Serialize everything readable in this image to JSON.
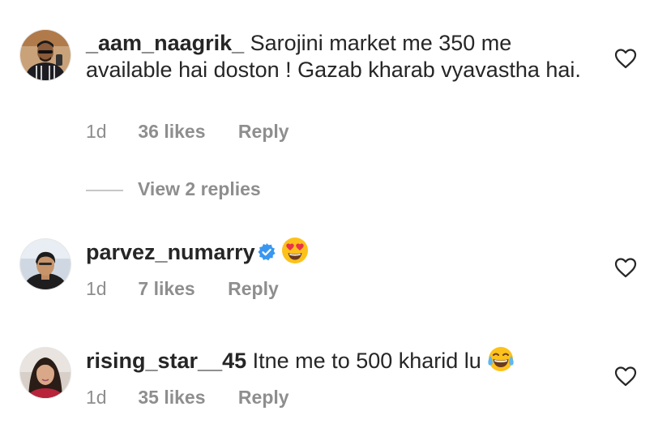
{
  "colors": {
    "text_primary": "#262626",
    "text_secondary": "#8e8e8e",
    "verified_blue": "#3897f0"
  },
  "comments": [
    {
      "username": "_aam_naagrik_",
      "text": "Sarojini market me 350 me available hai doston ! Gazab kharab vyavastha hai.",
      "time": "1d",
      "likes": "36 likes",
      "reply": "Reply",
      "view_replies": "View 2 replies"
    },
    {
      "username": "parvez_numarry",
      "verified": true,
      "text": "",
      "emoji": "heart-eyes-emoji",
      "time": "1d",
      "likes": "7 likes",
      "reply": "Reply"
    },
    {
      "username": "rising_star__45",
      "text": "Itne me to 500 kharid lu",
      "emoji": "tears-of-joy-emoji",
      "time": "1d",
      "likes": "35 likes",
      "reply": "Reply"
    }
  ]
}
